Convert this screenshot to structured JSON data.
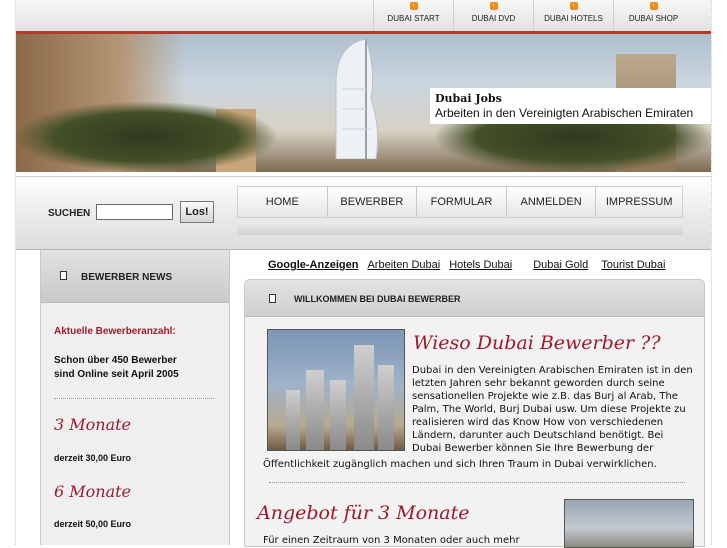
{
  "top_nav": {
    "items": [
      {
        "label": "DUBAI START"
      },
      {
        "label": "DUBAI DVD"
      },
      {
        "label": "DUBAI HOTELS"
      },
      {
        "label": "DUBAI SHOP"
      }
    ]
  },
  "header": {
    "title": "Dubai Jobs",
    "subtitle": "Arbeiten in den Vereinigten Arabischen Emiraten"
  },
  "search": {
    "label": "SUCHEN",
    "value": "",
    "button": "Los!"
  },
  "main_nav": {
    "items": [
      {
        "label": "HOME"
      },
      {
        "label": "BEWERBER"
      },
      {
        "label": "FORMULAR"
      },
      {
        "label": "ANMELDEN"
      },
      {
        "label": "IMPRESSUM"
      }
    ]
  },
  "sidebar": {
    "title": "BEWERBER NEWS",
    "count_heading": "Aktuelle Bewerberanzahl:",
    "count_line1": "Schon über 450 Bewerber",
    "count_line2": "sind Online seit April 2005",
    "offer1_title": "3 Monate",
    "offer1_price": "derzeit 30,00 Euro",
    "offer2_title": "6 Monate",
    "offer2_price": "derzeit 50,00 Euro"
  },
  "ads": {
    "lead": "Google-Anzeigen",
    "links": [
      "Arbeiten Dubai",
      "Hotels Dubai",
      "Dubai Gold",
      "Tourist Dubai"
    ]
  },
  "content": {
    "box_title": "WILLKOMMEN BEI DUBAI BEWERBER",
    "heading": "Wieso Dubai Bewerber ??",
    "p_lines": [
      "Dubai in den Vereinigten Arabischen Emiraten ist in den",
      "letzten Jahren sehr bekannt geworden durch seine",
      "sensationellen Projekte wie z.B. das Burj al Arab, The",
      "Palm, The World, Burj Dubai usw. Um diese Projekte zu",
      "realisieren wird das Know How von verschiedenen",
      "Ländern, darunter auch Deutschland benötigt. Bei",
      "Dubai Bewerber können Sie Ihre Bewerbung der"
    ],
    "p_last": "Öffentlichkeit zugänglich machen und sich Ihren Traum in Dubai verwirklichen.",
    "offer_heading": "Angebot für 3 Monate",
    "offer_text": "Für einen Zeitraum von 3 Monaten oder auch mehr"
  },
  "colors": {
    "accent_red": "#9b1b2e",
    "nav_dot_orange": "#f08a1c",
    "top_rule": "#b33a2a"
  }
}
